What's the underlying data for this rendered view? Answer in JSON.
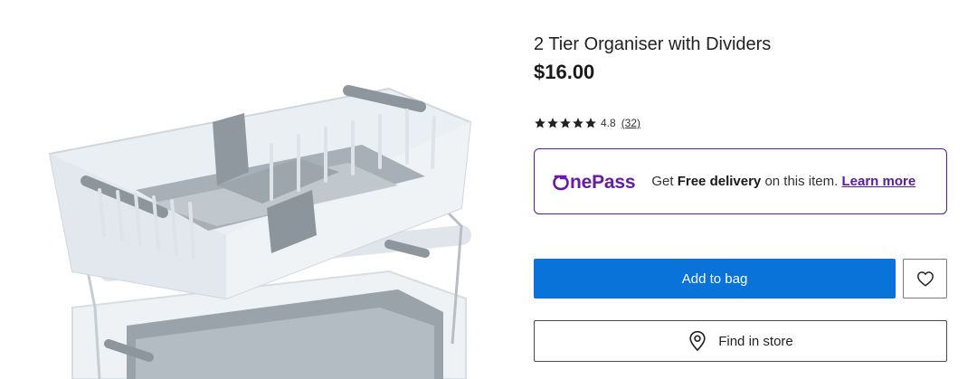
{
  "product": {
    "title": "2 Tier Organiser with Dividers",
    "price": "$16.00",
    "image_alt": "product-image"
  },
  "rating": {
    "stars": 4.8,
    "value": "4.8",
    "count": "(32)"
  },
  "onepass": {
    "logo": "OnePass",
    "text_get": "Get ",
    "text_bold": "Free delivery",
    "text_rest": " on this item. ",
    "learn_more": "Learn more"
  },
  "actions": {
    "add_to_bag": "Add to bag",
    "wishlist_icon": "heart-icon",
    "find_in_store": "Find in store",
    "find_in_store_icon": "location-pin-icon"
  },
  "colors": {
    "primary_button": "#0a73d9",
    "onepass_purple": "#5b1b9a"
  }
}
